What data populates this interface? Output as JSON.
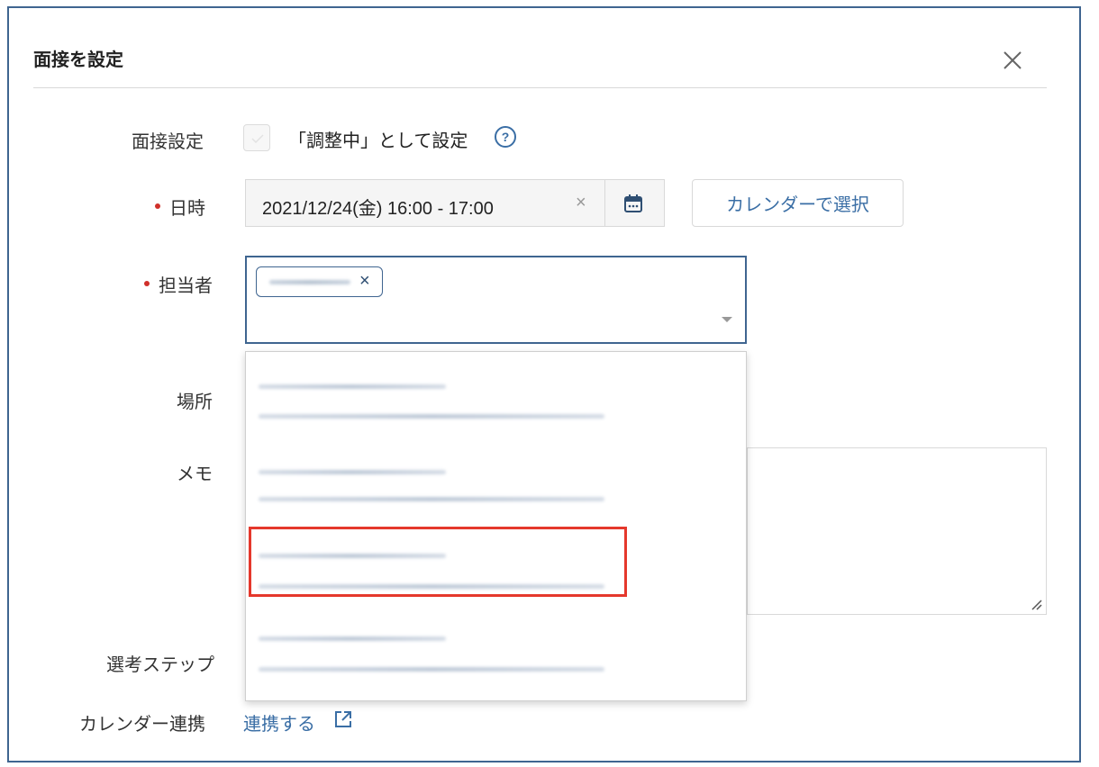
{
  "dialog": {
    "title": "面接を設定",
    "close_icon": "close-icon"
  },
  "form": {
    "interview_setting": {
      "label": "面接設定",
      "checkbox_label": "「調整中」として設定",
      "checked": false,
      "help_icon": "question-circle-icon"
    },
    "datetime": {
      "label": "日時",
      "required": true,
      "value": "2021/12/24(金) 16:00 - 17:00",
      "clear_icon": "×",
      "calendar_icon": "calendar-icon"
    },
    "calendar_select_button": "カレンダーで選択",
    "assignee": {
      "label": "担当者",
      "required": true,
      "tag_remove_icon": "×",
      "dropdown_icon": "caret-down-icon"
    },
    "location": {
      "label": "場所"
    },
    "memo": {
      "label": "メモ"
    },
    "selection_step": {
      "label": "選考ステップ"
    },
    "calendar_link": {
      "label": "カレンダー連携",
      "link_text": "連携する",
      "link_icon": "external-link-icon"
    }
  },
  "colors": {
    "accent": "#3a6ea5",
    "border_active": "#3f6590",
    "required": "#d0302a",
    "highlight": "#e5382c"
  }
}
